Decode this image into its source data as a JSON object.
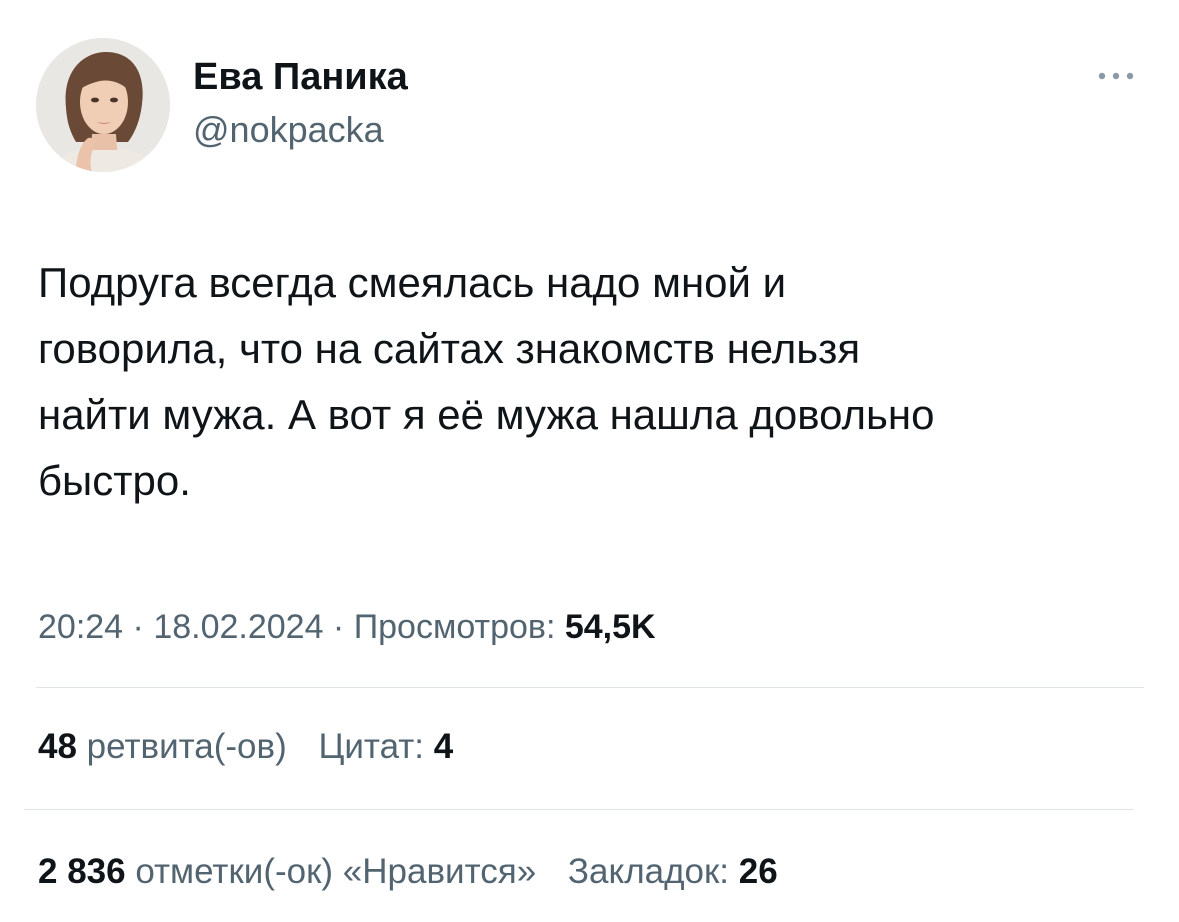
{
  "author": {
    "display_name": "Ева Паника",
    "handle": "@nokpacka"
  },
  "icons": {
    "more": "more-horizontal-icon",
    "avatar": "avatar-image"
  },
  "tweet": {
    "lines": [
      "Подруга всегда смеялась надо мной и",
      "говорила, что на сайтах знакомств нельзя",
      "найти мужа. А вот я её мужа нашла довольно",
      "быстро."
    ]
  },
  "meta": {
    "time": "20:24",
    "separator": " · ",
    "date": "18.02.2024",
    "views_label": "Просмотров:",
    "views_value": "54,5K"
  },
  "stats": {
    "retweets_count": "48",
    "retweets_label": "ретвита(-ов)",
    "quotes_label": "Цитат:",
    "quotes_count": "4",
    "likes_count": "2 836",
    "likes_label": "отметки(-ок) «Нравится»",
    "bookmarks_label": "Закладок:",
    "bookmarks_count": "26"
  },
  "colors": {
    "text_primary": "#0f1419",
    "text_secondary": "#536471",
    "divider": "#e1e5e8",
    "background": "#ffffff"
  }
}
